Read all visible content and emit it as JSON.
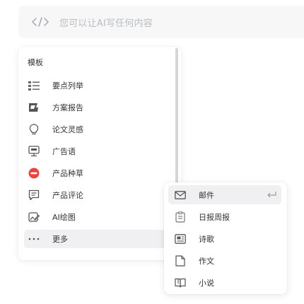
{
  "input": {
    "placeholder": "您可以让AI写任何内容"
  },
  "templates": {
    "title": "模板",
    "items": [
      {
        "label": "要点列举",
        "icon": "bullet-list-icon"
      },
      {
        "label": "方案报告",
        "icon": "report-icon"
      },
      {
        "label": "论文灵感",
        "icon": "lightbulb-icon"
      },
      {
        "label": "广告语",
        "icon": "billboard-icon"
      },
      {
        "label": "产品种草",
        "icon": "product-recommend-icon"
      },
      {
        "label": "产品评论",
        "icon": "comment-icon"
      },
      {
        "label": "AI绘图",
        "icon": "ai-drawing-icon"
      },
      {
        "label": "更多",
        "icon": "more-icon"
      }
    ]
  },
  "submenu": {
    "items": [
      {
        "label": "邮件",
        "icon": "mail-icon"
      },
      {
        "label": "日报周报",
        "icon": "clipboard-icon"
      },
      {
        "label": "诗歌",
        "icon": "poem-icon"
      },
      {
        "label": "作文",
        "icon": "document-icon"
      },
      {
        "label": "小说",
        "icon": "book-icon"
      }
    ]
  },
  "colors": {
    "icon": "#555555",
    "icon_light": "#888888",
    "placeholder": "#b9bcc2",
    "badge_red": "#e8453c",
    "active_bg": "#f0f0f2"
  }
}
